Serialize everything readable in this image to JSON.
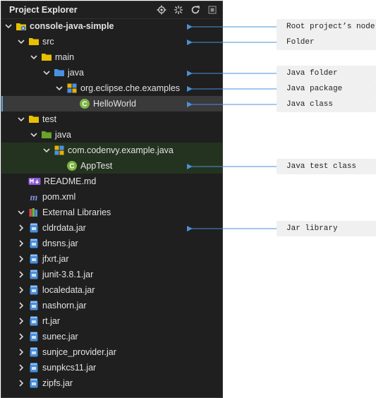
{
  "panel": {
    "title": "Project Explorer"
  },
  "toolbar": [
    {
      "name": "locate-icon"
    },
    {
      "name": "collapse-all-icon"
    },
    {
      "name": "refresh-icon"
    },
    {
      "name": "minimize-icon"
    }
  ],
  "tree": [
    {
      "label": "console-java-simple",
      "depth": 0,
      "chevron": "down",
      "icon": "root-project",
      "bold": true
    },
    {
      "label": "src",
      "depth": 1,
      "chevron": "down",
      "icon": "folder-yellow"
    },
    {
      "label": "main",
      "depth": 2,
      "chevron": "down",
      "icon": "folder-yellow"
    },
    {
      "label": "java",
      "depth": 3,
      "chevron": "down",
      "icon": "folder-blue"
    },
    {
      "label": "org.eclipse.che.examples",
      "depth": 4,
      "chevron": "down",
      "icon": "package"
    },
    {
      "label": "HelloWorld",
      "depth": 5,
      "chevron": "none",
      "icon": "class",
      "state": "selected"
    },
    {
      "label": "test",
      "depth": 1,
      "chevron": "down",
      "icon": "folder-yellow"
    },
    {
      "label": "java",
      "depth": 2,
      "chevron": "down",
      "icon": "folder-green"
    },
    {
      "label": "com.codenvy.example.java",
      "depth": 3,
      "chevron": "down",
      "icon": "package",
      "state": "test"
    },
    {
      "label": "AppTest",
      "depth": 4,
      "chevron": "none",
      "icon": "class",
      "state": "test"
    },
    {
      "label": "README.md",
      "depth": 1,
      "chevron": "none",
      "icon": "markdown"
    },
    {
      "label": "pom.xml",
      "depth": 1,
      "chevron": "none",
      "icon": "maven"
    },
    {
      "label": "External Libraries",
      "depth": 0,
      "chevron": "down",
      "icon": "libraries",
      "indent": 1
    },
    {
      "label": "cldrdata.jar",
      "depth": 1,
      "chevron": "right",
      "icon": "jar"
    },
    {
      "label": "dnsns.jar",
      "depth": 1,
      "chevron": "right",
      "icon": "jar"
    },
    {
      "label": "jfxrt.jar",
      "depth": 1,
      "chevron": "right",
      "icon": "jar"
    },
    {
      "label": "junit-3.8.1.jar",
      "depth": 1,
      "chevron": "right",
      "icon": "jar"
    },
    {
      "label": "localedata.jar",
      "depth": 1,
      "chevron": "right",
      "icon": "jar"
    },
    {
      "label": "nashorn.jar",
      "depth": 1,
      "chevron": "right",
      "icon": "jar"
    },
    {
      "label": "rt.jar",
      "depth": 1,
      "chevron": "right",
      "icon": "jar"
    },
    {
      "label": "sunec.jar",
      "depth": 1,
      "chevron": "right",
      "icon": "jar"
    },
    {
      "label": "sunjce_provider.jar",
      "depth": 1,
      "chevron": "right",
      "icon": "jar"
    },
    {
      "label": "sunpkcs11.jar",
      "depth": 1,
      "chevron": "right",
      "icon": "jar"
    },
    {
      "label": "zipfs.jar",
      "depth": 1,
      "chevron": "right",
      "icon": "jar"
    }
  ],
  "callouts": [
    {
      "text": "Root project’s node",
      "row": 0
    },
    {
      "text": "Folder",
      "row": 1
    },
    {
      "text": "Java folder",
      "row": 3
    },
    {
      "text": "Java package",
      "row": 4
    },
    {
      "text": "Java class",
      "row": 5
    },
    {
      "text": "Java test class",
      "row": 9
    },
    {
      "text": "Jar library",
      "row": 13
    }
  ],
  "colors": {
    "panel_bg": "#1f1f1f",
    "selected_bg": "#3a3a3a",
    "test_bg": "#24331f",
    "folder_yellow": "#e8c000",
    "folder_blue": "#4a90e2",
    "folder_green": "#6aa22a",
    "class_green": "#7cb342",
    "jar_blue": "#4a8fd8",
    "markdown": "#8e5ad8",
    "maven": "#7d8fe0",
    "arrow": "#4a90d9",
    "callout_bg": "#f0f0f0"
  }
}
